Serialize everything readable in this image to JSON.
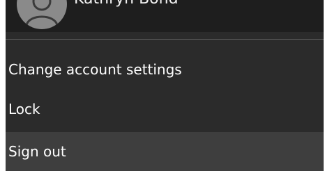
{
  "user": {
    "name": "Kathryn Bond",
    "avatar_icon": "person-icon"
  },
  "menu": {
    "items": [
      {
        "label": "Change account settings"
      },
      {
        "label": "Lock"
      },
      {
        "label": "Sign out",
        "highlighted": true
      }
    ]
  },
  "colors": {
    "menu_background": "#2b2b2b",
    "header_background": "#1e1e1e",
    "highlight_background": "#3e3e3e",
    "text": "#ffffff"
  }
}
